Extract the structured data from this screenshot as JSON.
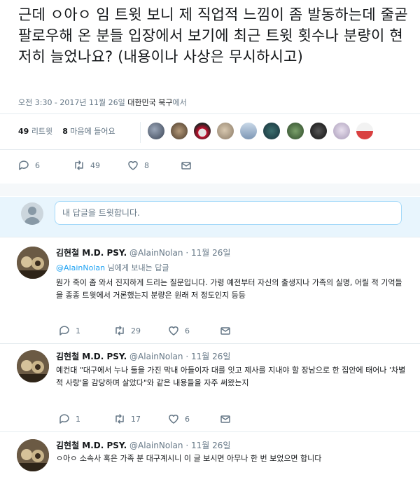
{
  "tweet": {
    "text": "근데 ㅇ아ㅇ 임 트윗 보니 제 직업적 느낌이 좀 발동하는데 줄곧 팔로우해 온 분들 입장에서 보기에 최근 트윗 횟수나 분량이 현저히 늘었나요? (내용이나 사상은 무시하시고)",
    "time": "오전 3:30 - 2017년 11월 26일",
    "location": "대한민국 북구",
    "location_suffix": "에서",
    "retweets_count": "49",
    "retweets_label": "리트윗",
    "likes_count": "8",
    "likes_label": "마음에 들어요",
    "actions": {
      "reply": "6",
      "retweet": "49",
      "like": "8"
    }
  },
  "reply_box": {
    "placeholder": "내 답글을 트윗합니다."
  },
  "replies": [
    {
      "name": "김현철 M.D. PSY.",
      "handle": "@AlainNolan",
      "sep": "·",
      "date": "11월 26일",
      "sub_mention": "@AlainNolan",
      "sub_text": " 님에게 보내는 답글",
      "text": "뭔가 죽이 좀 와서 진지하게 드리는 질문입니다. 가령 예전부터 자신의 출생지나 가족의 실명, 어릴 적 기억들을 종종 트윗에서 거론했는지 분량은 원래 저 정도인지 등등",
      "actions": {
        "reply": "1",
        "retweet": "29",
        "like": "6"
      }
    },
    {
      "name": "김현철 M.D. PSY.",
      "handle": "@AlainNolan",
      "sep": "·",
      "date": "11월 26일",
      "text": "예컨대 \"대구에서 누나 둘을 가진 막내 아들이자 대를 잇고 제사를 지내야 할 장남으로 한 집안에 태어나 '차별적 사랑'을 감당하며 살았다\"와 같은 내용들을 자주 써왔는지",
      "actions": {
        "reply": "1",
        "retweet": "17",
        "like": "6"
      }
    },
    {
      "name": "김현철 M.D. PSY.",
      "handle": "@AlainNolan",
      "sep": "·",
      "date": "11월 26일",
      "text": "ㅇ아ㅇ 소속사 혹은 가족 분 대구계시니 이 글 보시면 아무나 한 번 보었으면 합니다"
    }
  ],
  "colors": {
    "accent": "#1da1f2",
    "text": "#14171a",
    "muted": "#657786",
    "divider": "#e6ecf0",
    "reply_bg": "#e8f5fd"
  }
}
